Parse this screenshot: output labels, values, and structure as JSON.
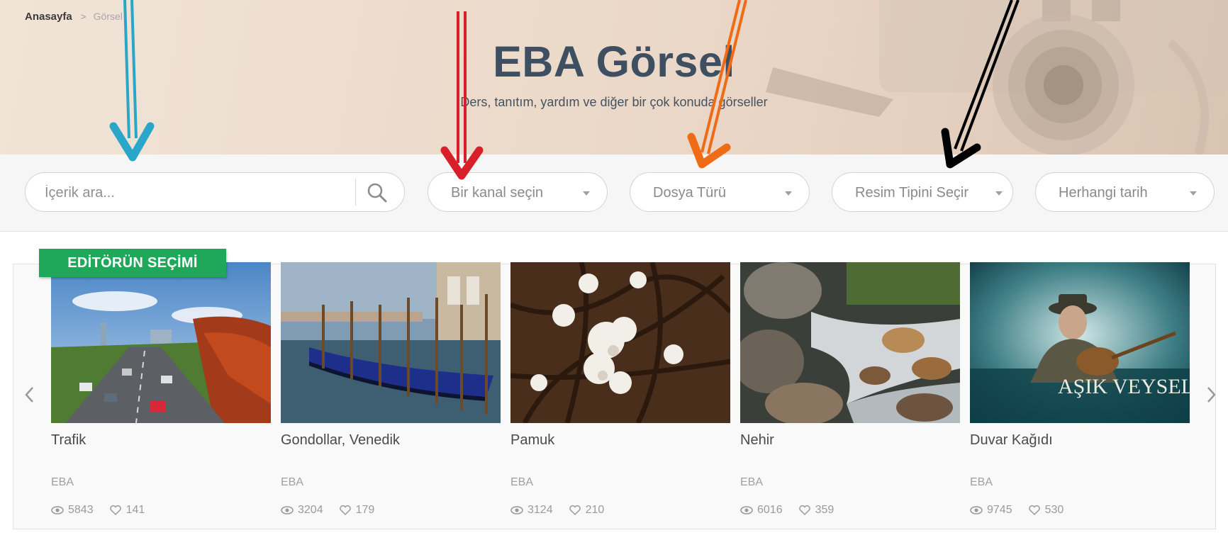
{
  "breadcrumb": {
    "home": "Anasayfa",
    "separator": ">",
    "current": "Görsel"
  },
  "hero": {
    "title": "EBA Görsel",
    "subtitle": "Ders, tanıtım, yardım ve diğer bir çok konuda görseller"
  },
  "filters": {
    "search": {
      "placeholder": "İçerik ara...",
      "value": "",
      "icon": "search-icon"
    },
    "channel": {
      "label": "Bir kanal seçin"
    },
    "file_type": {
      "label": "Dosya Türü"
    },
    "image_type": {
      "label": "Resim Tipini Seçir"
    },
    "date": {
      "label": "Herhangi tarih"
    }
  },
  "editor_badge": "EDİTÖRÜN SEÇİMİ",
  "cards": [
    {
      "title": "Trafik",
      "channel": "EBA",
      "views": "5843",
      "likes": "141"
    },
    {
      "title": "Gondollar, Venedik",
      "channel": "EBA",
      "views": "3204",
      "likes": "179"
    },
    {
      "title": "Pamuk",
      "channel": "EBA",
      "views": "3124",
      "likes": "210"
    },
    {
      "title": "Nehir",
      "channel": "EBA",
      "views": "6016",
      "likes": "359"
    },
    {
      "title": "Duvar Kağıdı",
      "channel": "EBA",
      "views": "9745",
      "likes": "530"
    }
  ],
  "thumb_texts": {
    "asik_veysel": "AŞIK VEYSEL"
  },
  "icons": {
    "prev": "chevron-left-icon",
    "next": "chevron-right-icon",
    "views": "eye-icon",
    "likes": "heart-icon"
  },
  "colors": {
    "title": "#3d4f60",
    "badge_green": "#1fa85a",
    "annotation_blue": "#2aa6c8",
    "annotation_red": "#d8202b",
    "annotation_orange": "#ef6b15",
    "annotation_black": "#000000"
  }
}
